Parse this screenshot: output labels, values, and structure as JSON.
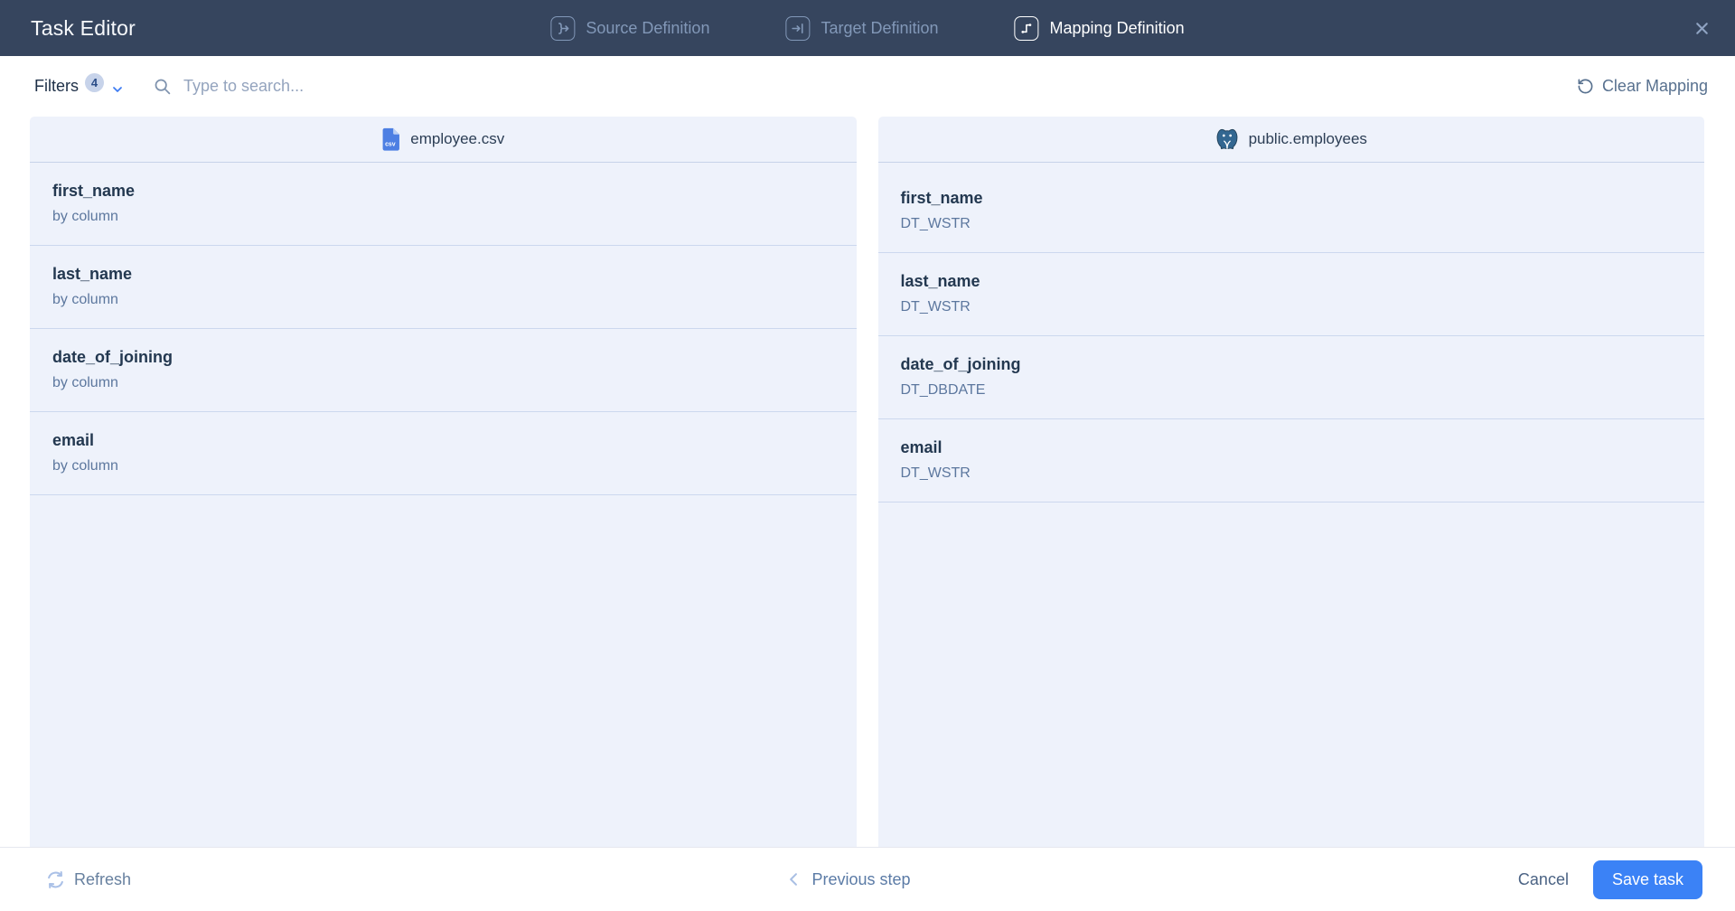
{
  "header": {
    "title": "Task Editor",
    "tabs": [
      {
        "label": "Source Definition",
        "active": false
      },
      {
        "label": "Target Definition",
        "active": false
      },
      {
        "label": "Mapping Definition",
        "active": true
      }
    ]
  },
  "toolbar": {
    "filters_label": "Filters",
    "filters_count": "4",
    "search_placeholder": "Type to search...",
    "search_value": "",
    "clear_mapping_label": "Clear Mapping"
  },
  "source_panel": {
    "title": "employee.csv",
    "icon": "csv-file-icon",
    "fields": [
      {
        "name": "first_name",
        "sub": "by column"
      },
      {
        "name": "last_name",
        "sub": "by column"
      },
      {
        "name": "date_of_joining",
        "sub": "by column"
      },
      {
        "name": "email",
        "sub": "by column"
      }
    ]
  },
  "target_panel": {
    "title": "public.employees",
    "icon": "postgresql-icon",
    "fields": [
      {
        "name": "first_name",
        "sub": "DT_WSTR"
      },
      {
        "name": "last_name",
        "sub": "DT_WSTR"
      },
      {
        "name": "date_of_joining",
        "sub": "DT_DBDATE"
      },
      {
        "name": "email",
        "sub": "DT_WSTR"
      }
    ]
  },
  "footer": {
    "refresh_label": "Refresh",
    "previous_label": "Previous step",
    "cancel_label": "Cancel",
    "save_label": "Save task"
  },
  "colors": {
    "header_bg": "#36455e",
    "accent_blue": "#3b82f6",
    "panel_bg": "#eef2fb",
    "inactive_tab": "#8298b8",
    "csv_icon_blue": "#4d7fe3",
    "postgres_blue": "#336791",
    "row_name_text": "#233850",
    "row_sub_text": "#5c779e"
  },
  "icons": {
    "source_tab": "source-definition-icon (brace + right arrow)",
    "target_tab": "target-definition-icon (right arrow into bar)",
    "mapping_tab": "mapping-definition-icon (step connector with dots)",
    "close": "close-icon (x)",
    "filters_chevron": "chevron-down-icon",
    "search": "search-icon (magnifier)",
    "clear_mapping": "reset-icon (counterclockwise arrow)",
    "source_file": "csv-file-icon",
    "target_db": "postgresql-icon (elephant)",
    "refresh": "refresh-icon (two circular arrows)",
    "previous": "chevron-left-icon"
  }
}
